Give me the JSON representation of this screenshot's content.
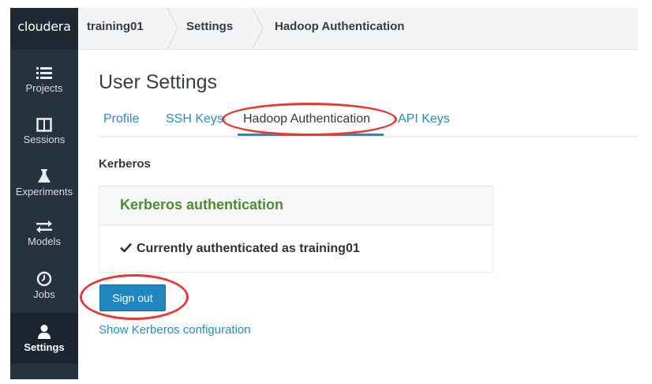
{
  "brand": "cloudera",
  "breadcrumbs": [
    "training01",
    "Settings",
    "Hadoop Authentication"
  ],
  "sidebar": {
    "items": [
      {
        "label": "Projects",
        "icon": "list-icon"
      },
      {
        "label": "Sessions",
        "icon": "columns-icon"
      },
      {
        "label": "Experiments",
        "icon": "flask-icon"
      },
      {
        "label": "Models",
        "icon": "arrows-icon"
      },
      {
        "label": "Jobs",
        "icon": "clock-icon"
      },
      {
        "label": "Settings",
        "icon": "user-icon",
        "active": true
      }
    ]
  },
  "main": {
    "title": "User Settings",
    "tabs": [
      {
        "label": "Profile"
      },
      {
        "label": "SSH Keys"
      },
      {
        "label": "Hadoop Authentication",
        "active": true
      },
      {
        "label": "API Keys"
      }
    ],
    "section_label": "Kerberos",
    "panel": {
      "title": "Kerberos authentication",
      "status": "Currently authenticated as training01"
    },
    "signout_label": "Sign out",
    "show_config_link": "Show Kerberos configuration"
  },
  "colors": {
    "sidebar": "#27323f",
    "accent": "#1f86c0",
    "link": "#2b8bc3",
    "success": "#4e8d2b",
    "annotation": "#e53935"
  }
}
